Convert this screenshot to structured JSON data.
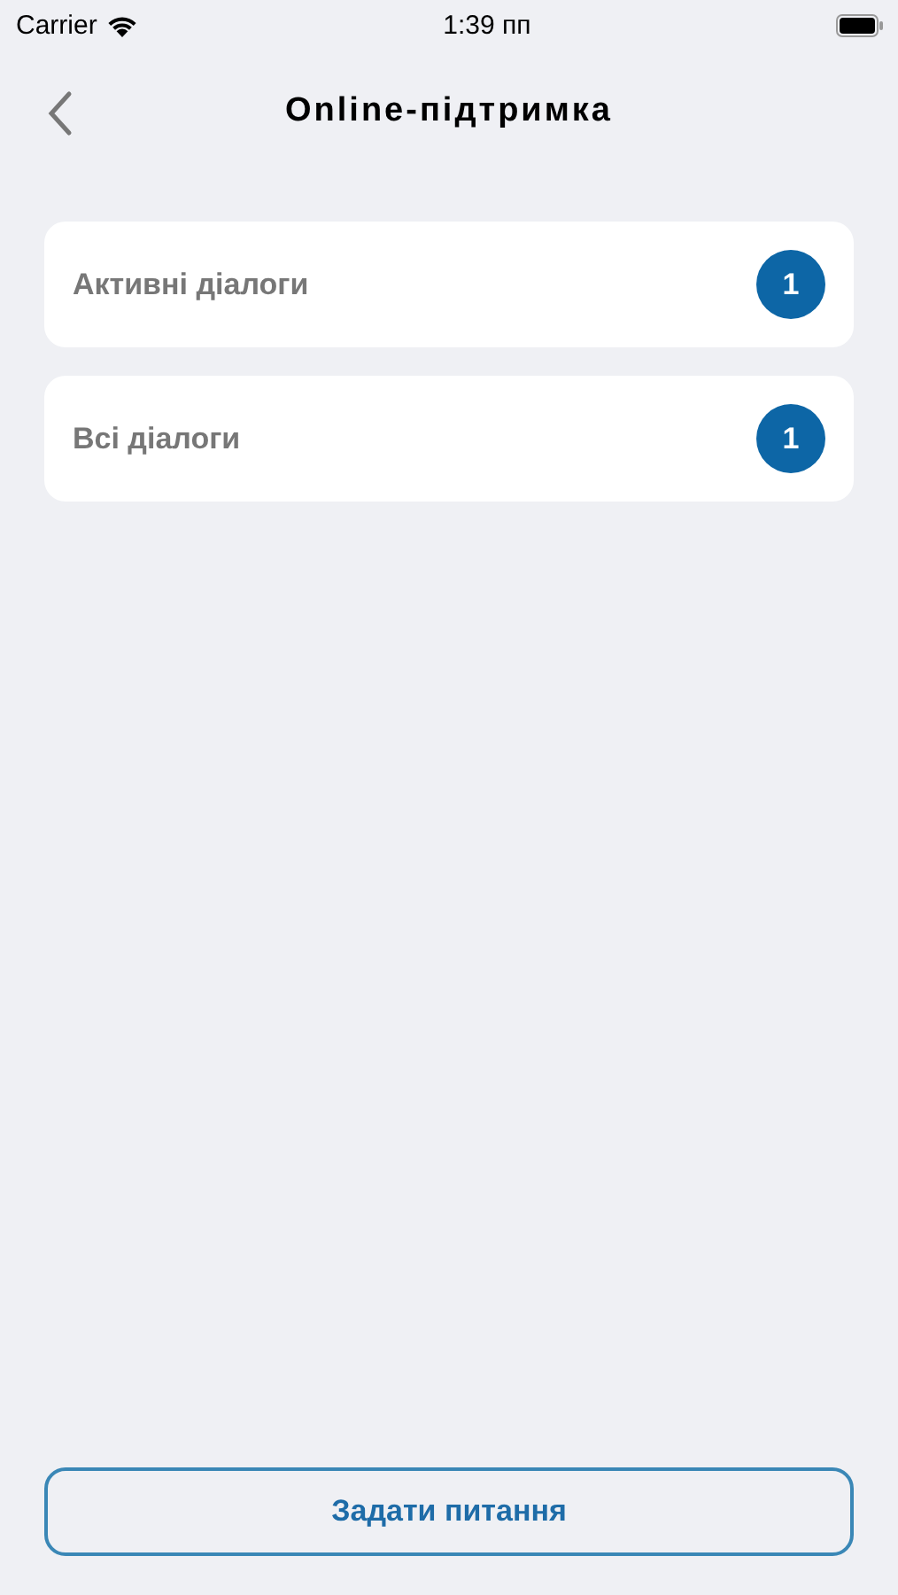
{
  "status_bar": {
    "carrier": "Carrier",
    "time": "1:39 пп"
  },
  "nav": {
    "title": "Online-підтримка"
  },
  "items": [
    {
      "label": "Активні діалоги",
      "count": "1"
    },
    {
      "label": "Всі діалоги",
      "count": "1"
    }
  ],
  "button": {
    "label": "Задати питання"
  }
}
